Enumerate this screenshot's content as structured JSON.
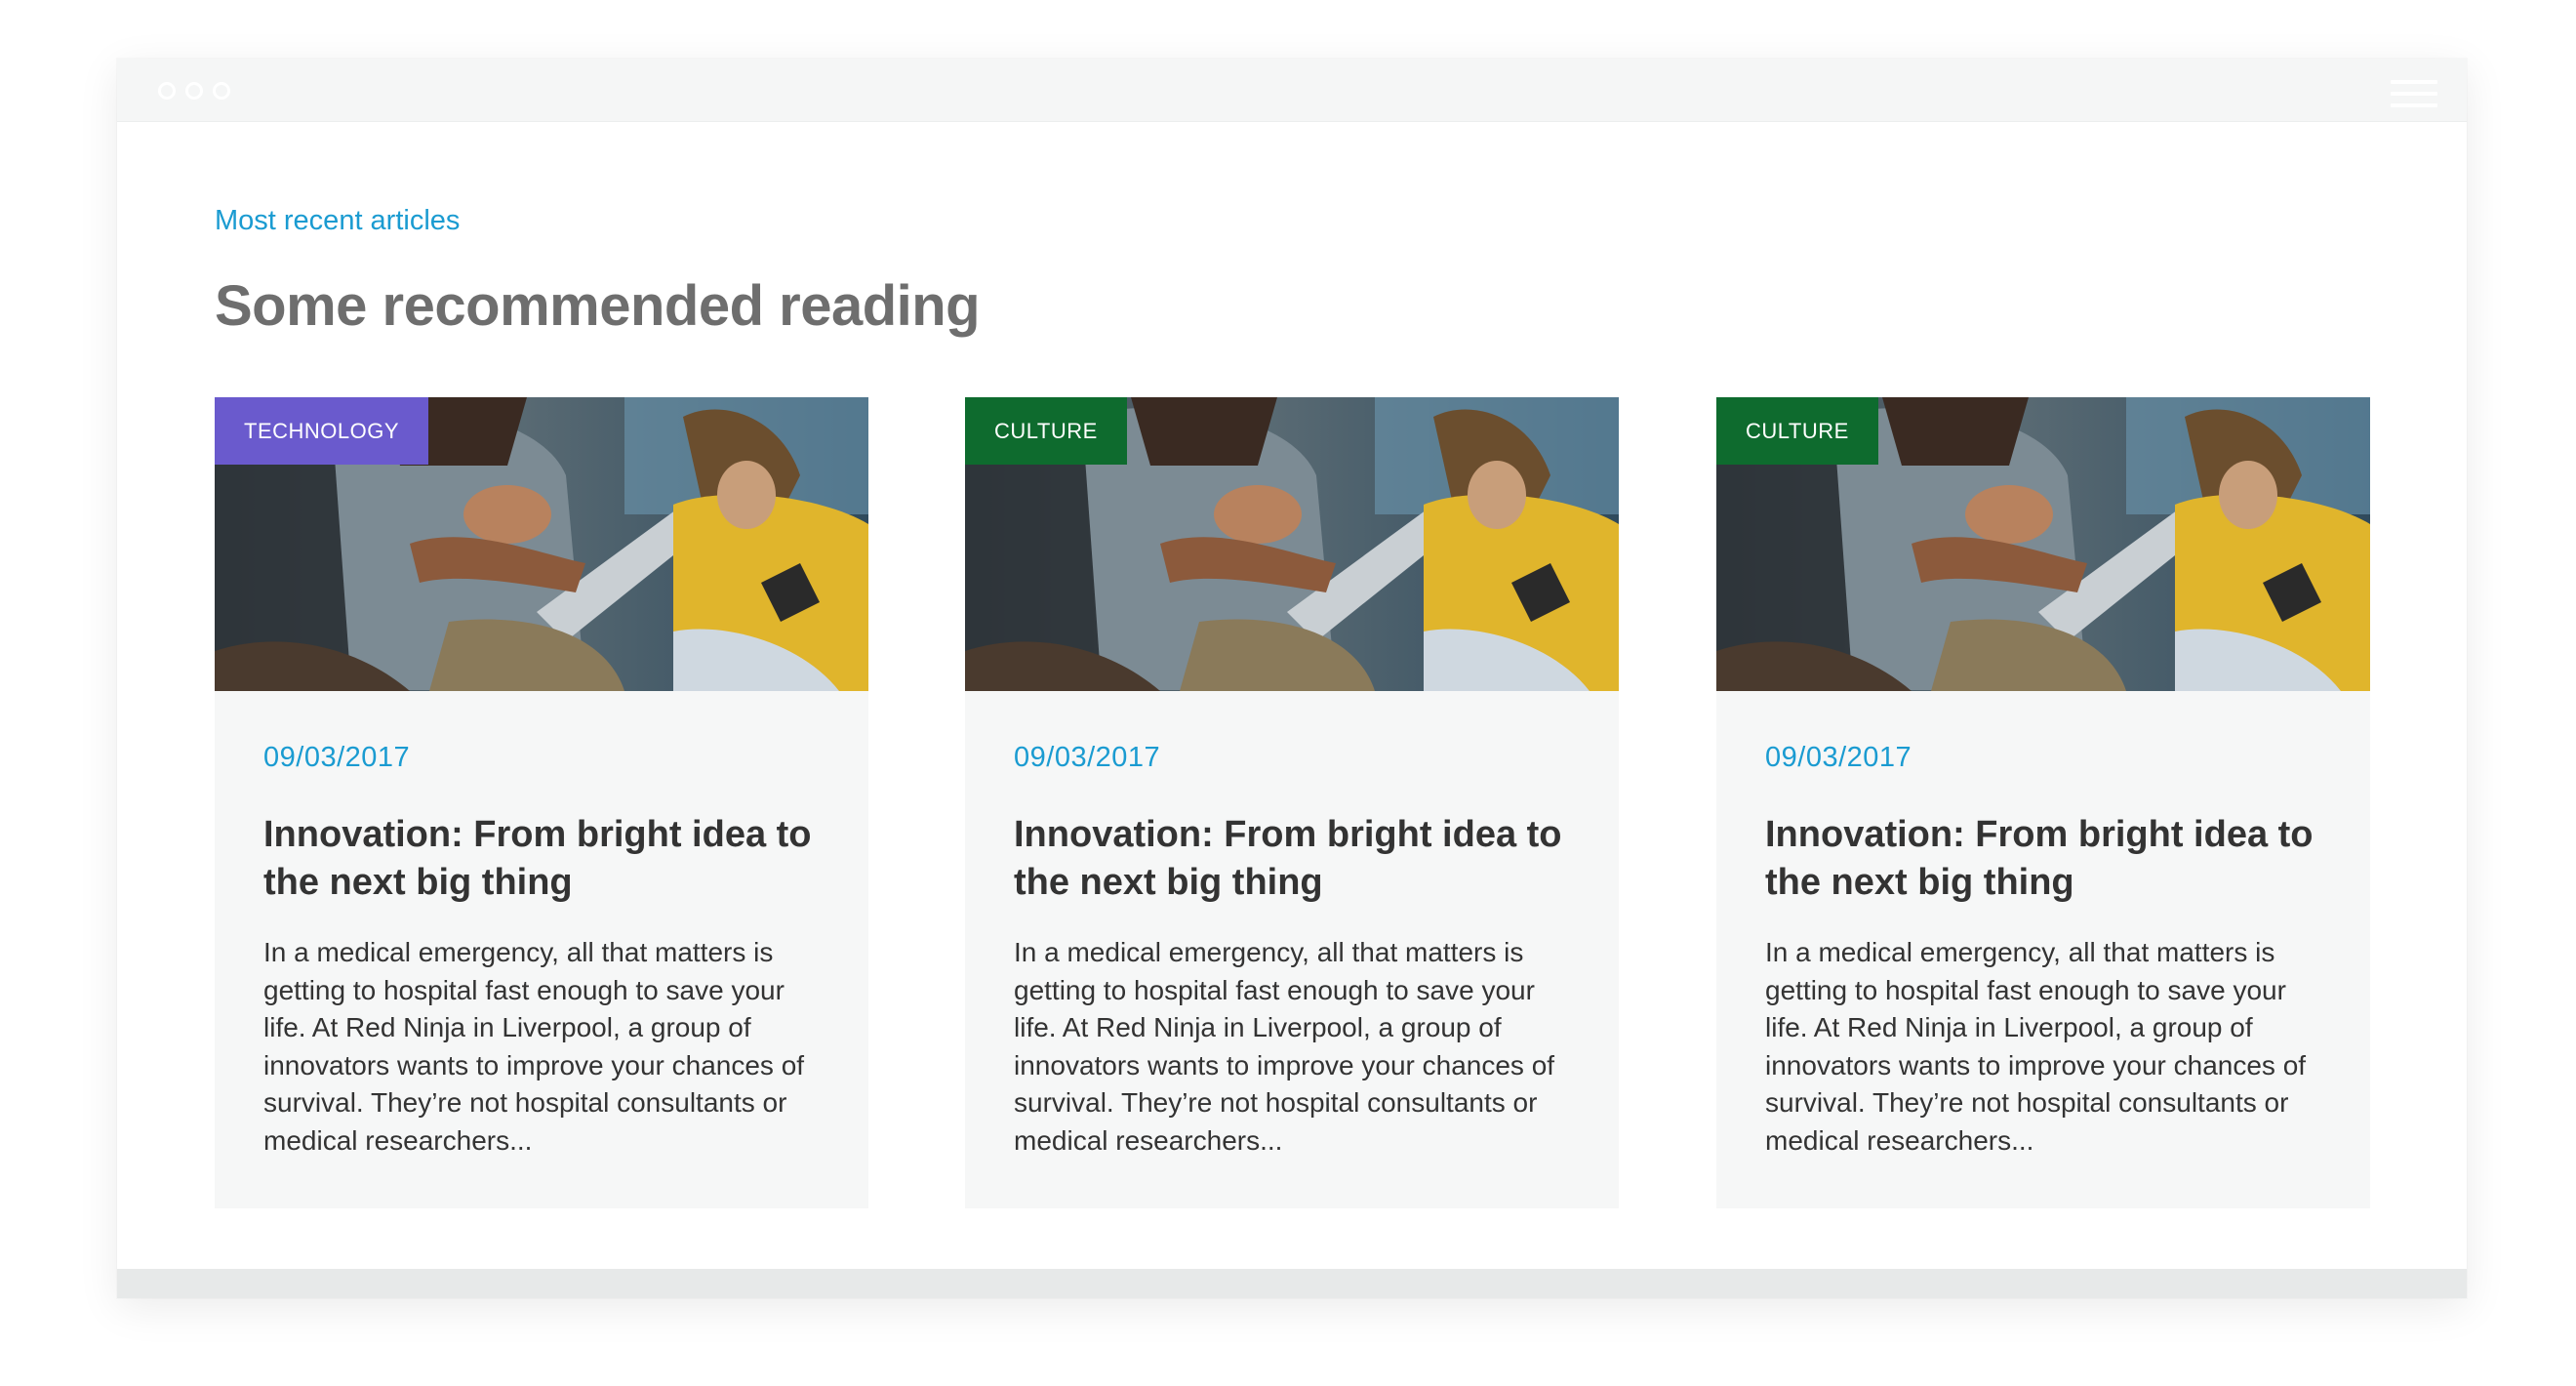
{
  "section": {
    "eyebrow": "Most recent articles",
    "heading": "Some recommended reading"
  },
  "articles": [
    {
      "tag": "TECHNOLOGY",
      "tag_color": "#6a5acd",
      "date": "09/03/2017",
      "title": "Innovation: From bright idea to the next big thing",
      "excerpt": "In a medical emergency, all that matters is getting to hospital fast enough to save your life. At Red Ninja in Liverpool, a group of innovators wants to improve your chances of survival. They’re not hospital consultants or medical researchers..."
    },
    {
      "tag": "CULTURE",
      "tag_color": "#0e6b2e",
      "date": "09/03/2017",
      "title": "Innovation: From bright idea to the next big thing",
      "excerpt": "In a medical emergency, all that matters is getting to hospital fast enough to save your life. At Red Ninja in Liverpool, a group of innovators wants to improve your chances of survival. They’re not hospital consultants or medical researchers..."
    },
    {
      "tag": "CULTURE",
      "tag_color": "#0e6b2e",
      "date": "09/03/2017",
      "title": "Innovation: From bright idea to the next big thing",
      "excerpt": "In a medical emergency, all that matters is getting to hospital fast enough to save your life. At Red Ninja in Liverpool, a group of innovators wants to improve your chances of survival. They’re not hospital consultants or medical researchers..."
    }
  ],
  "colors": {
    "accent": "#1a9bd1",
    "heading": "#6e6e6e",
    "card_bg": "#f6f7f7",
    "text": "#333333"
  },
  "icons": {
    "window_controls": "traffic-light-dots",
    "menu": "hamburger-menu-icon"
  }
}
